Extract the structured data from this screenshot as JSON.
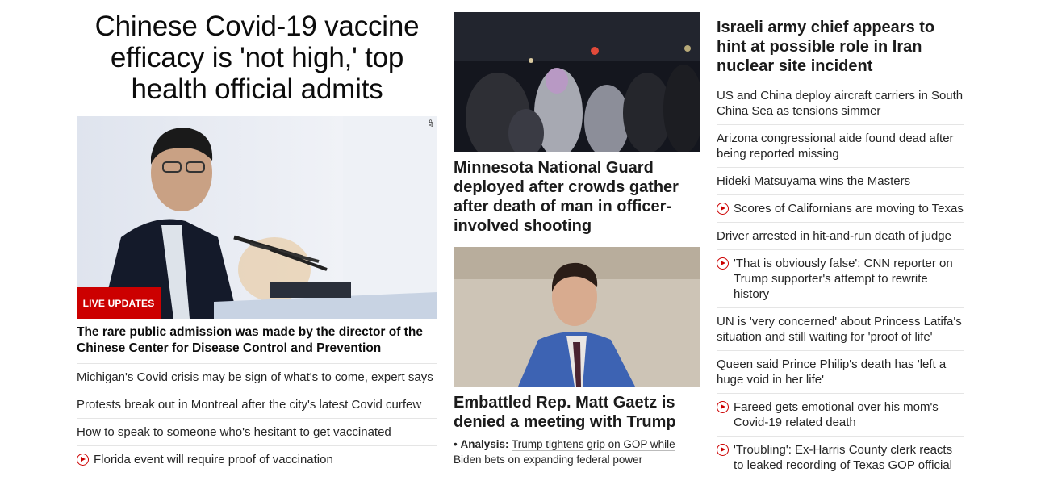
{
  "left": {
    "headline": "Chinese Covid-19 vaccine efficacy is 'not high,' top health official admits",
    "image_credit": "AP",
    "badge": "LIVE UPDATES",
    "summary": "The rare public admission was made by the director of the Chinese Center for Disease Control and Prevention",
    "items": [
      {
        "text": "Michigan's Covid crisis may be sign of what's to come, expert says",
        "video": false
      },
      {
        "text": "Protests break out in Montreal after the city's latest Covid curfew",
        "video": false
      },
      {
        "text": "How to speak to someone who's hesitant to get vaccinated",
        "video": false
      },
      {
        "text": "Florida event will require proof of vaccination",
        "video": true
      }
    ]
  },
  "middle": {
    "story1": {
      "headline": "Minnesota National Guard deployed after crowds gather after death of man in officer-involved shooting"
    },
    "story2": {
      "headline": "Embattled Rep. Matt Gaetz is denied a meeting with Trump",
      "analysis_label": "Analysis:",
      "analysis_text": "Trump tightens grip on GOP while Biden bets on expanding federal power"
    }
  },
  "right": {
    "headline": "Israeli army chief appears to hint at possible role in Iran nuclear site incident",
    "items": [
      {
        "text": "US and China deploy aircraft carriers in South China Sea as tensions simmer",
        "video": false
      },
      {
        "text": "Arizona congressional aide found dead after being reported missing",
        "video": false
      },
      {
        "text": "Hideki Matsuyama wins the Masters",
        "video": false
      },
      {
        "text": "Scores of Californians are moving to Texas",
        "video": true
      },
      {
        "text": "Driver arrested in hit-and-run death of judge",
        "video": false
      },
      {
        "text": "'That is obviously false': CNN reporter on Trump supporter's attempt to rewrite history",
        "video": true
      },
      {
        "text": "UN is 'very concerned' about Princess Latifa's situation and still waiting for 'proof of life'",
        "video": false
      },
      {
        "text": "Queen said Prince Philip's death has 'left a huge void in her life'",
        "video": false
      },
      {
        "text": "Fareed gets emotional over his mom's Covid-19 related death",
        "video": true
      },
      {
        "text": "'Troubling': Ex-Harris County clerk reacts to leaked recording of Texas GOP official",
        "video": true
      }
    ]
  },
  "colors": {
    "accent": "#cc0000",
    "text": "#262626",
    "divider": "#e5e5e5"
  }
}
